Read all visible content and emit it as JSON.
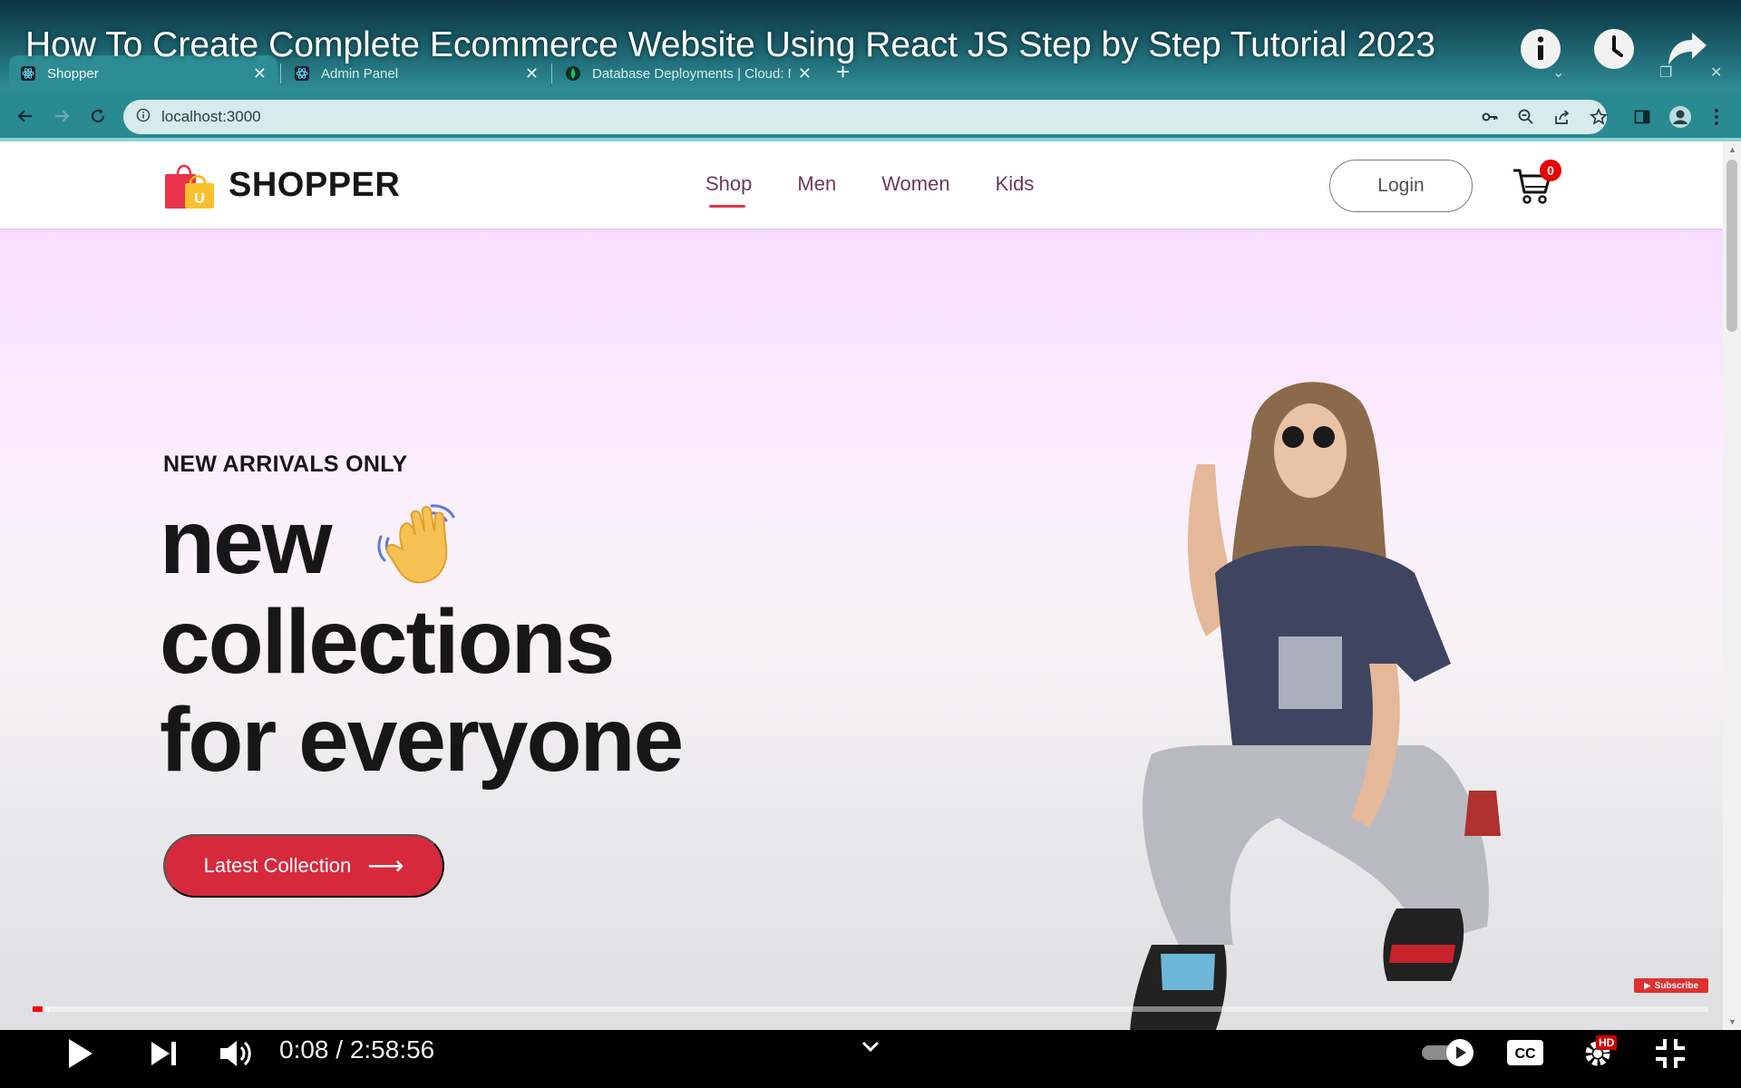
{
  "video": {
    "title": "How To Create Complete Ecommerce Website Using React JS Step by Step Tutorial 2023",
    "time": "0:08 / 2:58:56",
    "progress": 0.0008,
    "subscribe_label": "Subscribe",
    "hd_label": "HD"
  },
  "browser": {
    "tabs": [
      {
        "label": "Shopper",
        "active": true
      },
      {
        "label": "Admin Panel",
        "active": false
      },
      {
        "label": "Database Deployments | Cloud: M",
        "active": false
      }
    ],
    "url": "localhost:3000"
  },
  "site": {
    "logo_text": "SHOPPER",
    "logo_badge": "U",
    "menu": [
      {
        "label": "Shop",
        "active": true
      },
      {
        "label": "Men",
        "active": false
      },
      {
        "label": "Women",
        "active": false
      },
      {
        "label": "Kids",
        "active": false
      }
    ],
    "login_label": "Login",
    "cart_count": "0",
    "hero": {
      "tag": "NEW ARRIVALS ONLY",
      "line1": "new",
      "line2": "collections",
      "line3": "for everyone",
      "button_label": "Latest Collection"
    }
  },
  "colors": {
    "accent": "#e8334a",
    "hero_button": "#d62a3c",
    "browser_theme": "#2a8a92"
  }
}
